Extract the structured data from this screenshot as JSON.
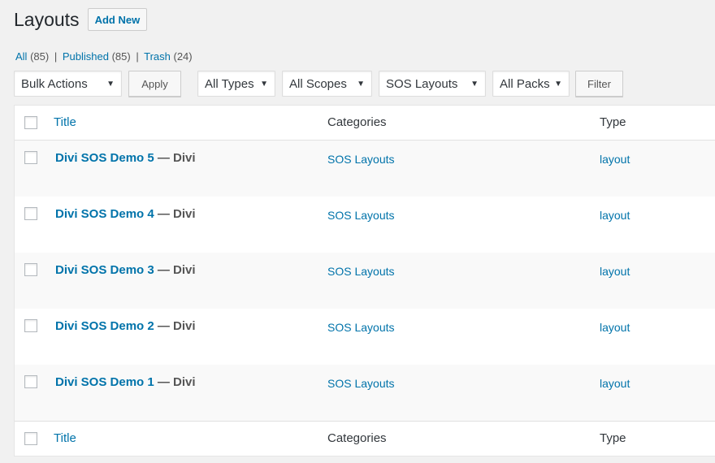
{
  "page_title": "Layouts",
  "add_new_label": "Add New",
  "views": [
    {
      "label": "All",
      "count": "(85)"
    },
    {
      "label": "Published",
      "count": "(85)"
    },
    {
      "label": "Trash",
      "count": "(24)"
    }
  ],
  "view_separator": "|",
  "filters": {
    "bulk_actions": "Bulk Actions",
    "apply_label": "Apply",
    "types": "All Types",
    "scopes": "All Scopes",
    "category": "SOS Layouts",
    "packs": "All Packs",
    "filter_label": "Filter",
    "arrow": "▼"
  },
  "columns": {
    "title": "Title",
    "categories": "Categories",
    "type": "Type"
  },
  "rows": [
    {
      "title": "Divi SOS Demo 5",
      "state": " — Divi",
      "category": "SOS Layouts",
      "type": "layout"
    },
    {
      "title": "Divi SOS Demo 4",
      "state": " — Divi",
      "category": "SOS Layouts",
      "type": "layout"
    },
    {
      "title": "Divi SOS Demo 3",
      "state": " — Divi",
      "category": "SOS Layouts",
      "type": "layout"
    },
    {
      "title": "Divi SOS Demo 2",
      "state": " — Divi",
      "category": "SOS Layouts",
      "type": "layout"
    },
    {
      "title": "Divi SOS Demo 1",
      "state": " — Divi",
      "category": "SOS Layouts",
      "type": "layout"
    }
  ]
}
